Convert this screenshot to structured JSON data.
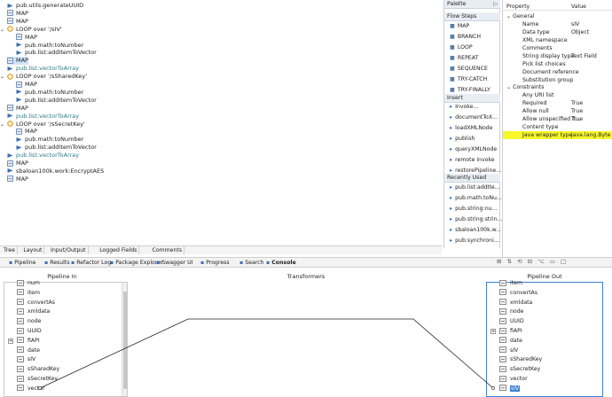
{
  "flow_steps": [
    {
      "text": "pub.utils:generateUUID",
      "type": "invoke",
      "level": 1
    },
    {
      "text": "MAP",
      "type": "map",
      "level": 1
    },
    {
      "text": "MAP",
      "type": "map",
      "level": 1
    },
    {
      "text": "LOOP over '/sIV'",
      "type": "loop",
      "level": 1
    },
    {
      "text": "MAP",
      "type": "map",
      "level": 2
    },
    {
      "text": "pub.math:toNumber",
      "type": "invoke",
      "level": 2
    },
    {
      "text": "pub.list:addItemToVector",
      "type": "invoke",
      "level": 2
    },
    {
      "text": "MAP",
      "type": "map",
      "level": 1,
      "selected": true
    },
    {
      "text": "pub.list:vectorToArray",
      "type": "invoke",
      "level": 1,
      "muted": true
    },
    {
      "text": "LOOP over '/sSharedKey'",
      "type": "loop",
      "level": 1
    },
    {
      "text": "MAP",
      "type": "map",
      "level": 2
    },
    {
      "text": "pub.math:toNumber",
      "type": "invoke",
      "level": 2
    },
    {
      "text": "pub.list:addItemToVector",
      "type": "invoke",
      "level": 2
    },
    {
      "text": "MAP",
      "type": "map",
      "level": 1
    },
    {
      "text": "pub.list:vectorToArray",
      "type": "invoke",
      "level": 1,
      "muted": true
    },
    {
      "text": "LOOP over '/sSecretKey'",
      "type": "loop",
      "level": 1
    },
    {
      "text": "MAP",
      "type": "map",
      "level": 2
    },
    {
      "text": "pub.math:toNumber",
      "type": "invoke",
      "level": 2
    },
    {
      "text": "pub.list:addItemToVector",
      "type": "invoke",
      "level": 2
    },
    {
      "text": "pub.list:vectorToArray",
      "type": "invoke",
      "level": 1,
      "muted": true
    },
    {
      "text": "MAP",
      "type": "map",
      "level": 1
    },
    {
      "text": "sbaloan100k.work:EncryptAES",
      "type": "invoke",
      "level": 1
    },
    {
      "text": "MAP",
      "type": "map",
      "level": 1
    }
  ],
  "palette": {
    "title": "Palette",
    "flow_steps_header": "Flow Steps",
    "flow_steps": [
      "MAP",
      "BRANCH",
      "LOOP",
      "REPEAT",
      "SEQUENCE",
      "TRY-CATCH",
      "TRY-FINALLY"
    ],
    "insert_header": "Insert",
    "insert": [
      "Invoke...",
      "documentToX...",
      "loadXMLNode",
      "publish",
      "queryXMLNode",
      "remote invoke",
      "restorePipeline..."
    ],
    "recently_used_header": "Recently Used",
    "recently_used": [
      "pub.list:addIte...",
      "pub.math:toNu...",
      "pub.string:nu...",
      "pub.string:strin...",
      "sbaloan100k.w...",
      "pub.synchroni..."
    ]
  },
  "properties": {
    "col_property": "Property",
    "col_value": "Value",
    "general_label": "General",
    "general": [
      {
        "k": "Name",
        "v": "sIV"
      },
      {
        "k": "Data type",
        "v": "Object"
      },
      {
        "k": "XML namespace",
        "v": ""
      },
      {
        "k": "Comments",
        "v": ""
      },
      {
        "k": "String display type",
        "v": "Text Field"
      },
      {
        "k": "Pick list choices",
        "v": ""
      },
      {
        "k": "Document reference",
        "v": ""
      },
      {
        "k": "Substitution group",
        "v": ""
      }
    ],
    "constraints_label": "Constraints",
    "constraints": [
      {
        "k": "Any URI list",
        "v": ""
      },
      {
        "k": "Required",
        "v": "True"
      },
      {
        "k": "Allow null",
        "v": "True"
      },
      {
        "k": "Allow unspecified fi...",
        "v": "True"
      },
      {
        "k": "Content type",
        "v": ""
      },
      {
        "k": "Java wrapper type",
        "v": "java.lang.Byte",
        "highlight": true
      }
    ],
    "highlight_color": "#f7f72a"
  },
  "editor_tabs": [
    "Tree",
    "Layout",
    "Input/Output",
    "Logged Fields",
    "Comments"
  ],
  "bottom_tabs": [
    "Pipeline",
    "Results",
    "Refactor Log",
    "Package Explorer",
    "Swagger UI",
    "Progress",
    "Search",
    "Console"
  ],
  "pipeline": {
    "in_title": "Pipeline In",
    "transformers_title": "Transformers",
    "out_title": "Pipeline Out",
    "in_items": [
      "num",
      "item",
      "convertAs",
      "xmldata",
      "node",
      "UUID",
      "fiAPI",
      "date",
      "sIV",
      "sSharedKey",
      "sSecretKey",
      "vector"
    ],
    "out_items": [
      "item",
      "convertAs",
      "xmldata",
      "node",
      "UUID",
      "fiAPI",
      "date",
      "sIV",
      "sSharedKey",
      "sSecretKey",
      "vector",
      "sIV"
    ]
  }
}
